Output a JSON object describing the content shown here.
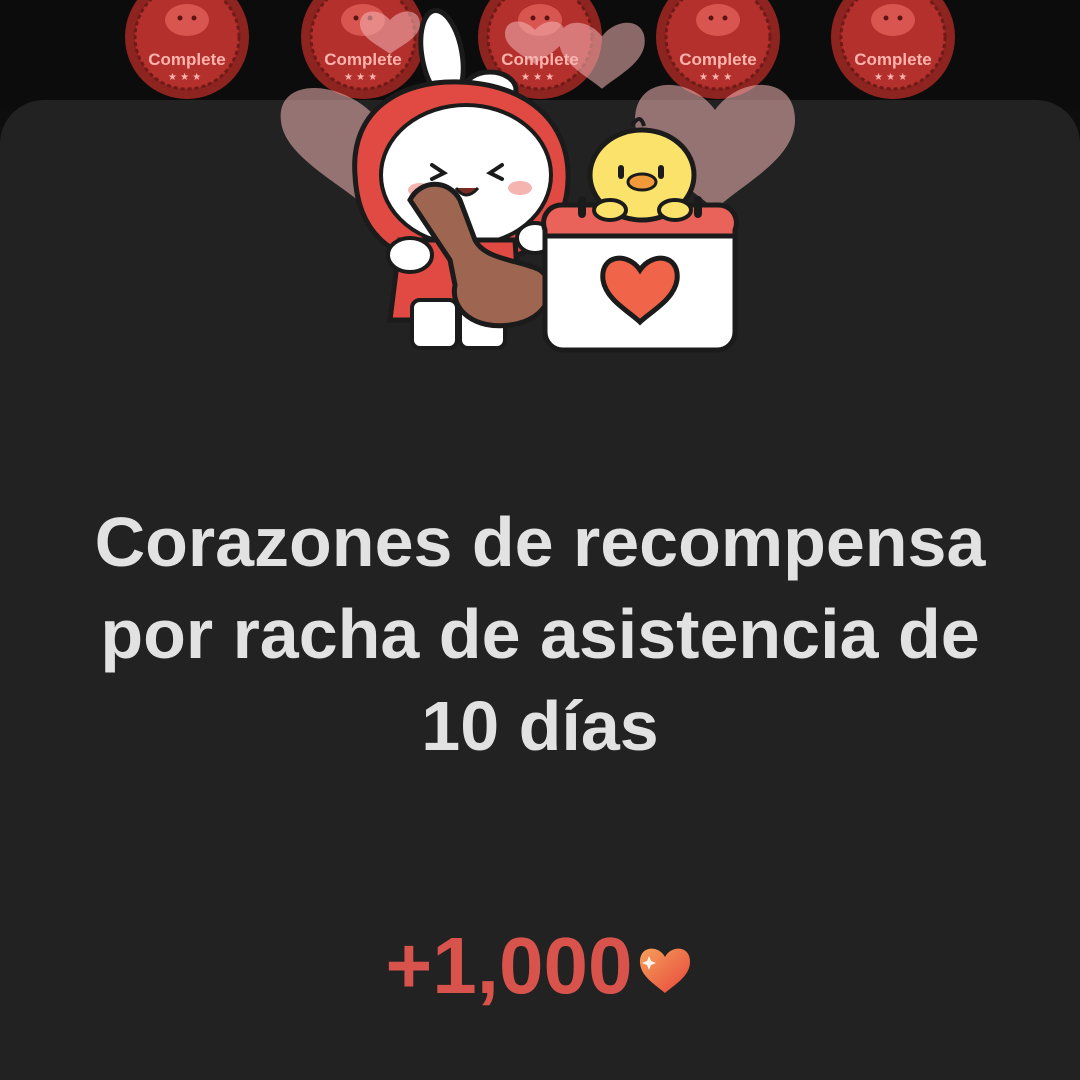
{
  "background": {
    "stamps": [
      {
        "label": "Complete",
        "icon": "complete-badge-icon"
      },
      {
        "label": "Complete",
        "icon": "complete-badge-icon"
      },
      {
        "label": "Complete",
        "icon": "complete-badge-icon"
      },
      {
        "label": "Complete",
        "icon": "complete-badge-icon"
      },
      {
        "label": "Complete",
        "icon": "complete-badge-icon"
      }
    ]
  },
  "illustration": {
    "characters": [
      "bunny-with-stamp-icon",
      "chick-icon"
    ],
    "calendar_icon": "calendar-heart-icon",
    "decor": "floating-hearts-icon"
  },
  "reward": {
    "title": "Corazones de recompensa por racha de asistencia de 10 días",
    "amount": "+1,000",
    "currency_icon": "heart-icon"
  },
  "colors": {
    "sheet_background": "#222222",
    "title_text": "#e2e2e2",
    "amount_text": "#d9534d",
    "stamp_red": "#b4302c",
    "heart_gradient": [
      "#f08a4b",
      "#e8453c"
    ]
  }
}
